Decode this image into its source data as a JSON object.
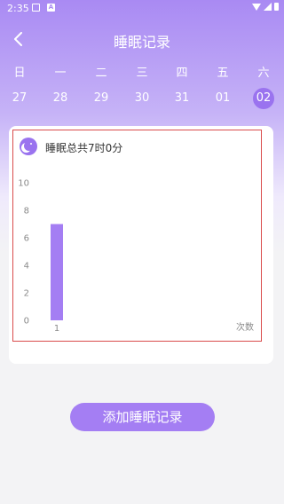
{
  "status_bar": {
    "time": "2:35"
  },
  "header": {
    "title": "睡眠记录"
  },
  "weekdays": [
    "日",
    "一",
    "二",
    "三",
    "四",
    "五",
    "六"
  ],
  "dates": [
    {
      "label": "27",
      "selected": false
    },
    {
      "label": "28",
      "selected": false
    },
    {
      "label": "29",
      "selected": false
    },
    {
      "label": "30",
      "selected": false
    },
    {
      "label": "31",
      "selected": false
    },
    {
      "label": "01",
      "selected": false
    },
    {
      "label": "02",
      "selected": true
    }
  ],
  "summary": {
    "text": "睡眠总共7时0分"
  },
  "chart_data": {
    "type": "bar",
    "categories": [
      "1"
    ],
    "values": [
      7
    ],
    "ylim": [
      0,
      10
    ],
    "yticks": [
      0,
      2,
      4,
      6,
      8,
      10
    ],
    "xlabel": "次数",
    "ylabel": "",
    "bar_color": "#a47ef3"
  },
  "actions": {
    "add_label": "添加睡眠记录"
  },
  "colors": {
    "accent": "#9a73ef",
    "button": "#a47ef3"
  }
}
